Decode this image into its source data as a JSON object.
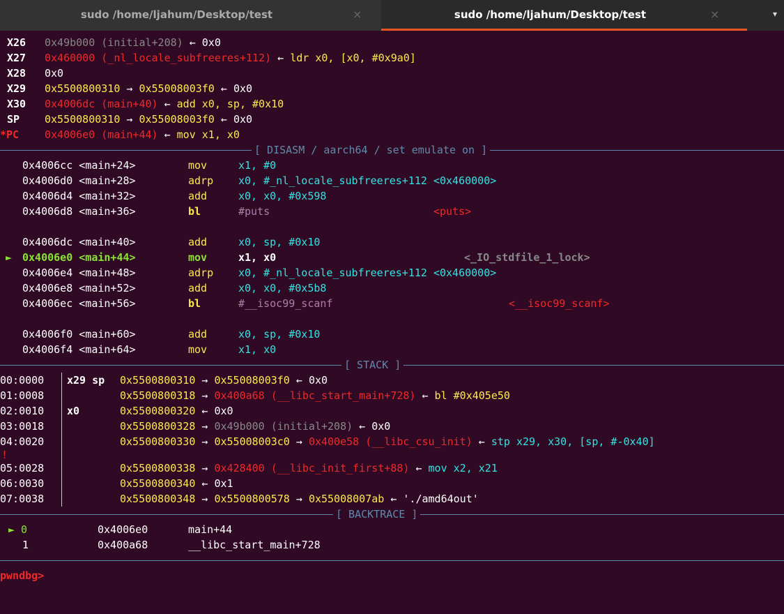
{
  "tabs": [
    {
      "title": "sudo /home/ljahum/Desktop/test",
      "close": "×",
      "active": false
    },
    {
      "title": "sudo /home/ljahum/Desktop/test",
      "close": "×",
      "active": true
    }
  ],
  "tab_menu_icon": "▾",
  "registers": [
    {
      "name": "X26",
      "parts": [
        "0x49b000 (initial+208)",
        " ← ",
        "0x0"
      ]
    },
    {
      "name": "X27",
      "parts": [
        "0x460000 (_nl_locale_subfreeres+112)",
        " ← ",
        "ldr x0, [x0, #0x9a0]"
      ]
    },
    {
      "name": "X28",
      "parts": [
        "0x0"
      ]
    },
    {
      "name": "X29",
      "parts": [
        "0x5500800310",
        " → ",
        "0x55008003f0",
        " ← ",
        "0x0"
      ]
    },
    {
      "name": "X30",
      "parts": [
        "0x4006dc (main+40)",
        " ← ",
        "add x0, sp, #0x10"
      ]
    },
    {
      "name": "SP",
      "parts": [
        "0x5500800310",
        " → ",
        "0x55008003f0",
        " ← ",
        "0x0"
      ]
    },
    {
      "name": "*PC",
      "parts": [
        "0x4006e0 (main+44)",
        " ← ",
        "mov x1, x0"
      ]
    }
  ],
  "sections": {
    "disasm": "[ DISASM / aarch64 / set emulate on ]",
    "stack": "[ STACK ]",
    "backtrace": "[ BACKTRACE ]"
  },
  "disasm": [
    {
      "marker": "",
      "addr": "0x4006cc <main+24>",
      "mnem": "mov",
      "ops": "x1, #0",
      "note": ""
    },
    {
      "marker": "",
      "addr": "0x4006d0 <main+28>",
      "mnem": "adrp",
      "ops": "x0, #_nl_locale_subfreeres+112 <0x460000>",
      "note": ""
    },
    {
      "marker": "",
      "addr": "0x4006d4 <main+32>",
      "mnem": "add",
      "ops": "x0, x0, #0x598",
      "note": ""
    },
    {
      "marker": "",
      "addr": "0x4006d8 <main+36>",
      "mnem": "bl",
      "ops": "#puts",
      "note": "<puts>"
    },
    {
      "blank": true
    },
    {
      "marker": "",
      "addr": "0x4006dc <main+40>",
      "mnem": "add",
      "ops": "x0, sp, #0x10",
      "note": ""
    },
    {
      "marker": "►",
      "addr": "0x4006e0 <main+44>",
      "mnem": "mov",
      "ops": "x1, x0",
      "note": "<_IO_stdfile_1_lock>"
    },
    {
      "marker": "",
      "addr": "0x4006e4 <main+48>",
      "mnem": "adrp",
      "ops": "x0, #_nl_locale_subfreeres+112 <0x460000>",
      "note": ""
    },
    {
      "marker": "",
      "addr": "0x4006e8 <main+52>",
      "mnem": "add",
      "ops": "x0, x0, #0x5b8",
      "note": ""
    },
    {
      "marker": "",
      "addr": "0x4006ec <main+56>",
      "mnem": "bl",
      "ops": "#__isoc99_scanf",
      "note": "<__isoc99_scanf>"
    },
    {
      "blank": true
    },
    {
      "marker": "",
      "addr": "0x4006f0 <main+60>",
      "mnem": "add",
      "ops": "x0, sp, #0x10",
      "note": ""
    },
    {
      "marker": "",
      "addr": "0x4006f4 <main+64>",
      "mnem": "mov",
      "ops": "x1, x0",
      "note": ""
    }
  ],
  "stack": [
    {
      "off": "00:0000",
      "regs": "x29 sp",
      "val": "0x5500800310",
      "chain": [
        " → ",
        "0x55008003f0",
        " ← ",
        "0x0"
      ]
    },
    {
      "off": "01:0008",
      "regs": "",
      "val": "0x5500800318",
      "chain": [
        " → ",
        "0x400a68 (__libc_start_main+728)",
        " ← ",
        "bl #0x405e50"
      ]
    },
    {
      "off": "02:0010",
      "regs": "x0",
      "val": "0x5500800320",
      "chain": [
        " ← ",
        "0x0"
      ]
    },
    {
      "off": "03:0018",
      "regs": "",
      "val": "0x5500800328",
      "chain": [
        " → ",
        "0x49b000 (initial+208)",
        " ← ",
        "0x0"
      ]
    },
    {
      "off": "04:0020",
      "regs": "",
      "val": "0x5500800330",
      "chain": [
        " → ",
        "0x55008003c0",
        " → ",
        "0x400e58 (__libc_csu_init)",
        " ← ",
        "stp x29, x30, [sp, #-0x40]"
      ]
    },
    {
      "off": "05:0028",
      "regs": "",
      "val": "0x5500800338",
      "chain": [
        " → ",
        "0x428400 (__libc_init_first+88)",
        " ← ",
        "mov x2, x21"
      ]
    },
    {
      "off": "06:0030",
      "regs": "",
      "val": "0x5500800340",
      "chain": [
        " ← ",
        "0x1"
      ]
    },
    {
      "off": "07:0038",
      "regs": "",
      "val": "0x5500800348",
      "chain": [
        " → ",
        "0x5500800578",
        " → ",
        "0x55008007ab",
        " ← ",
        "'./amd64out'"
      ]
    }
  ],
  "wrap_fragment": "!",
  "backtrace": [
    {
      "marker": "► 0",
      "addr": "0x4006e0",
      "sym": "main+44"
    },
    {
      "marker": "1",
      "addr": "0x400a68",
      "sym": "__libc_start_main+728"
    }
  ],
  "prompt": "pwndbg>"
}
